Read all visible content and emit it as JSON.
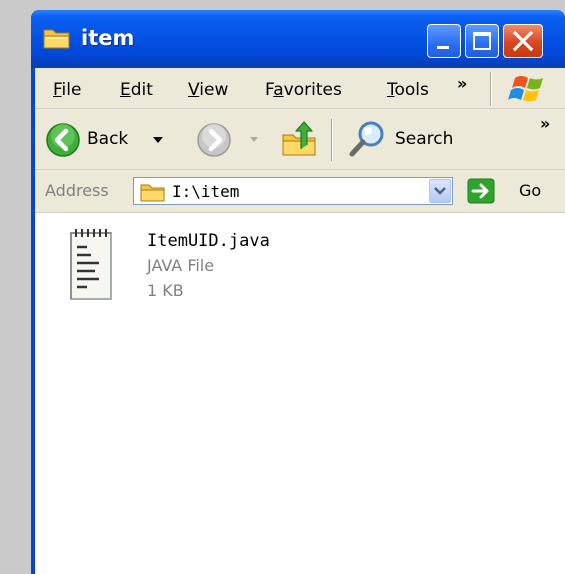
{
  "window": {
    "title": "item"
  },
  "menu": {
    "items": [
      {
        "key": "F",
        "rest": "ile"
      },
      {
        "key": "E",
        "rest": "dit"
      },
      {
        "key": "V",
        "rest": "iew"
      },
      {
        "pre": "F",
        "key": "a",
        "rest": "vorites"
      },
      {
        "key": "T",
        "rest": "ools"
      }
    ],
    "overflow": "»"
  },
  "toolbar": {
    "back_label": "Back",
    "search_label": "Search",
    "overflow": "»"
  },
  "address": {
    "label": "Address",
    "value": "I:\\item",
    "go_label": "Go"
  },
  "files": [
    {
      "name": "ItemUID.java",
      "type": "JAVA File",
      "size": "1 KB",
      "icon": "text-document-icon"
    }
  ],
  "colors": {
    "titlebar": "#0a5ff1",
    "close_button": "#d9461f",
    "chrome": "#ece9d8",
    "go_arrow": "#2ea42e"
  }
}
